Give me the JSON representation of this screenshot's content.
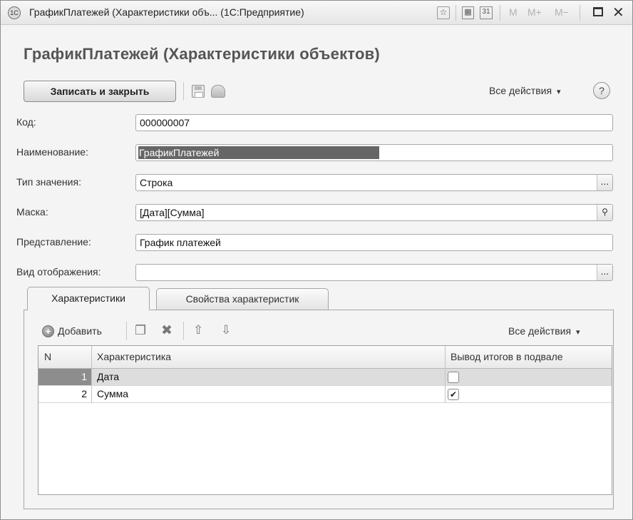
{
  "window": {
    "title": "ГрафикПлатежей (Характеристики объ...  (1С:Предприятие)",
    "app_icon_text": "1С",
    "memory_buttons": [
      "M",
      "M+",
      "M−"
    ]
  },
  "form": {
    "title": "ГрафикПлатежей (Характеристики объектов)",
    "save_close_label": "Записать и закрыть",
    "all_actions_label": "Все действия",
    "help_label": "?"
  },
  "fields": {
    "code": {
      "label": "Код:",
      "value": "000000007"
    },
    "name": {
      "label": "Наименование:",
      "value": "ГрафикПлатежей"
    },
    "value_type": {
      "label": "Тип значения:",
      "value": "Строка"
    },
    "mask": {
      "label": "Маска:",
      "value": "[Дата][Сумма]"
    },
    "presentation": {
      "label": "Представление:",
      "value": "График платежей"
    },
    "display_kind": {
      "label": "Вид отображения:",
      "value": ""
    }
  },
  "tabs": [
    {
      "label": "Характеристики",
      "active": true
    },
    {
      "label": "Свойства характеристик",
      "active": false
    }
  ],
  "table_toolbar": {
    "add_label": "Добавить",
    "all_actions_label": "Все действия"
  },
  "table": {
    "columns": [
      "N",
      "Характеристика",
      "Вывод итогов в подвале"
    ],
    "rows": [
      {
        "n": "1",
        "name": "Дата",
        "footer_total": false,
        "selected": true
      },
      {
        "n": "2",
        "name": "Сумма",
        "footer_total": true,
        "selected": false
      }
    ]
  },
  "glyphs": {
    "dropdown": "▾",
    "ellipsis": "...",
    "search": "🔍",
    "check": "✔",
    "close": "✕"
  },
  "icons": [
    "app-icon",
    "favorite-star-icon",
    "calculator-icon",
    "calendar-icon",
    "maximize-icon",
    "close-icon",
    "save-icon",
    "post-icon",
    "help-icon",
    "add-icon",
    "copy-icon",
    "delete-icon",
    "move-up-icon",
    "move-down-icon",
    "search-icon"
  ]
}
